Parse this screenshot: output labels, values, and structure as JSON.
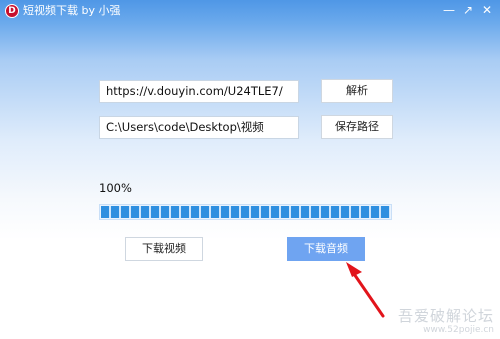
{
  "app": {
    "title": "短视频下载 by 小强",
    "icon_glyph": "D",
    "icon_color": "#c8102e"
  },
  "window_controls": {
    "minimize": "—",
    "restore": "↗",
    "close": "✕"
  },
  "url_input": {
    "value": "https://v.douyin.com/U24TLE7/"
  },
  "parse_button": {
    "label": "解析"
  },
  "path_input": {
    "value": "C:\\Users\\code\\Desktop\\视频"
  },
  "save_path_button": {
    "label": "保存路径"
  },
  "progress": {
    "text": "100%",
    "value": 1.0
  },
  "download_video_button": {
    "label": "下载视频"
  },
  "download_audio_button": {
    "label": "下载音频"
  },
  "watermark": {
    "text": "吾爱破解论坛",
    "url": "www.52pojie.cn"
  },
  "colors": {
    "titlebar": "#4f97e6",
    "primary_button": "#6fa4f1",
    "progress": "#2e8fe0",
    "annotation_arrow": "#e2141b"
  }
}
